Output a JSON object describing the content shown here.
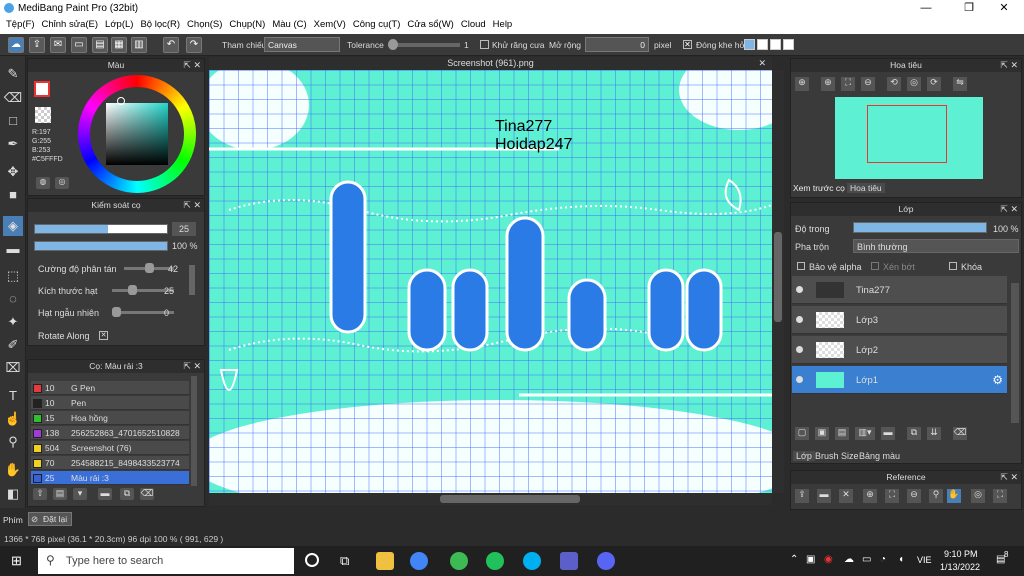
{
  "window": {
    "title": "MediBang Paint Pro (32bit)",
    "minimize": "—",
    "maximize": "❐",
    "close": "✕"
  },
  "menu": [
    "Tệp(F)",
    "Chỉnh sửa(E)",
    "Lớp(L)",
    "Bộ lọc(R)",
    "Chọn(S)",
    "Chụp(N)",
    "Màu (C)",
    "Xem(V)",
    "Công cụ(T)",
    "Cửa sổ(W)",
    "Cloud",
    "Help"
  ],
  "toolbar": {
    "ref_label": "Tham chiếu",
    "ref_value": "Canvas",
    "tolerance_label": "Tolerance",
    "tolerance_value": "1",
    "antialias_label": "Khử răng cưa",
    "expand_label": "Mở rộng",
    "expand_value": "0",
    "expand_unit": "pixel",
    "close_gap_label": "Đóng khe hở"
  },
  "color_panel": {
    "title": "Màu",
    "r": "R:197",
    "g": "G:255",
    "b": "B:253",
    "hex": "#C5FFFD"
  },
  "brush_control": {
    "title": "Kiểm soát cọ",
    "size_value": "25",
    "opacity_value": "100 %",
    "rows": [
      {
        "label": "Cường độ phân tán",
        "value": "42"
      },
      {
        "label": "Kích thước hạt",
        "value": "25"
      },
      {
        "label": "Hạt ngẫu nhiên",
        "value": "0"
      }
    ],
    "rotate_label": "Rotate Along",
    "rotate_check": "✕",
    "size_level": 0.55,
    "scatter_level": 0.42,
    "particle_level": 0.25,
    "random_level": 0.0
  },
  "brush_list": {
    "title": "Cọ: Màu rải :3",
    "items": [
      {
        "color": "#e83a3a",
        "size": "10",
        "name": "G Pen"
      },
      {
        "color": "#222222",
        "size": "10",
        "name": "Pen"
      },
      {
        "color": "#2fbf2f",
        "size": "15",
        "name": "Hoa hồng"
      },
      {
        "color": "#a03ad8",
        "size": "138",
        "name": "256252863_4701652510828"
      },
      {
        "color": "#f0d020",
        "size": "504",
        "name": "Screenshot (76)"
      },
      {
        "color": "#f0d020",
        "size": "70",
        "name": "254588215_8498433523774"
      },
      {
        "color": "#3a60d8",
        "size": "25",
        "name": "Màu rải :3",
        "selected": true
      }
    ]
  },
  "canvas": {
    "tab": "Screenshot (961).png",
    "text1": "Tina277",
    "text2": "Hoidap247"
  },
  "navigator": {
    "title": "Hoa tiêu",
    "tab1": "Xem trước cọ",
    "tab2": "Hoa tiêu"
  },
  "layers": {
    "title": "Lớp",
    "opacity_label": "Độ trong",
    "opacity_value": "100 %",
    "blend_label": "Pha trộn",
    "blend_value": "Bình thường",
    "protect_alpha": "Bảo vệ alpha",
    "clip": "Xén bớt",
    "lock": "Khóa",
    "items": [
      {
        "name": "Tina277"
      },
      {
        "name": "Lớp3"
      },
      {
        "name": "Lớp2"
      },
      {
        "name": "Lớp1",
        "selected": true
      }
    ],
    "tab_layer": "Lớp",
    "tab_brush": "Brush Size",
    "tab_palette": "Bảng màu"
  },
  "reference": {
    "title": "Reference"
  },
  "bottom": {
    "left_tab": "Phím",
    "undo": "Đặt lại"
  },
  "status": {
    "text": "1366 * 768 pixel   (36.1 * 20.3cm)   96 dpi   100 %   ( 991, 629 )"
  },
  "taskbar": {
    "search": "Type here to search",
    "lang": "VIE",
    "time": "9:10 PM",
    "date": "1/13/2022",
    "notif": "8"
  }
}
